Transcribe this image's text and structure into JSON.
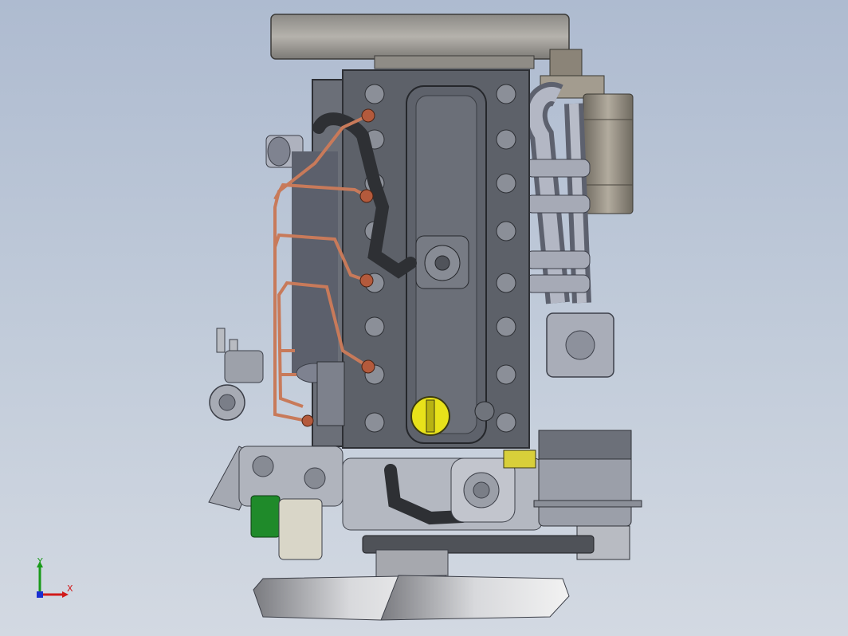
{
  "viewport": {
    "background_top": "#aebbd0",
    "background_bottom": "#d3d9e2"
  },
  "model": {
    "subject": "diesel-engine-assembly"
  },
  "triad": {
    "x_label": "X",
    "y_label": "Y",
    "x_color": "#d11a1a",
    "y_color": "#1a9a1a",
    "z_color": "#1a2fd1"
  },
  "colors": {
    "metal_dark": "#5c6068",
    "metal_mid": "#8a8f98",
    "metal_light": "#c4c8cf",
    "copper": "#c87a5a",
    "hose": "#2e3034",
    "oil_cap": "#e8e21a",
    "filter_green": "#1f8a2a",
    "cast_brown": "#9c9488"
  }
}
